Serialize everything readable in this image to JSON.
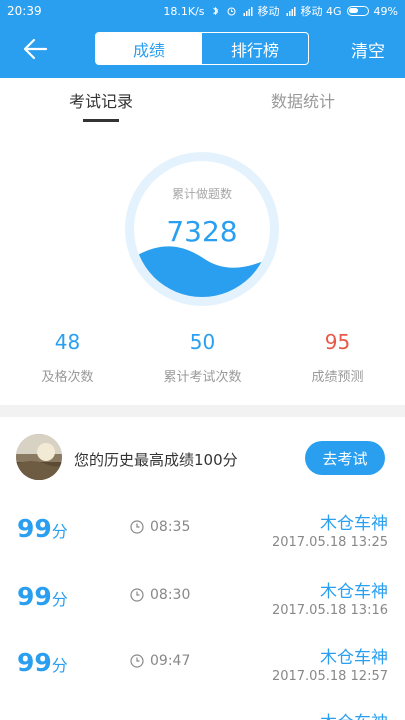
{
  "status_bar": {
    "time": "20:39",
    "speed": "18.1K/s",
    "carrier1": "移动",
    "carrier2": "移动 4G",
    "battery": "49%"
  },
  "nav": {
    "back_icon": "back-arrow-icon",
    "segments": [
      "成绩",
      "排行榜"
    ],
    "active_segment": "成绩",
    "clear_label": "清空"
  },
  "tabs": {
    "items": [
      "考试记录",
      "数据统计"
    ],
    "active": "考试记录"
  },
  "gauge": {
    "label": "累计做题数",
    "value": "7328",
    "fill_fraction": 0.3
  },
  "stats": [
    {
      "value": "48",
      "label": "及格次数"
    },
    {
      "value": "50",
      "label": "累计考试次数"
    },
    {
      "value": "95",
      "label": "成绩预测"
    }
  ],
  "best": {
    "text": "您的历史最高成绩100分",
    "button_label": "去考试"
  },
  "records": [
    {
      "score": "99",
      "unit": "分",
      "duration": "08:35",
      "name": "木仓车神",
      "date": "2017.05.18  13:25"
    },
    {
      "score": "99",
      "unit": "分",
      "duration": "08:30",
      "name": "木仓车神",
      "date": "2017.05.18  13:16"
    },
    {
      "score": "99",
      "unit": "分",
      "duration": "09:47",
      "name": "木仓车神",
      "date": "2017.05.18  12:57"
    },
    {
      "score": "",
      "unit": "",
      "duration": "",
      "name": "木仓车神",
      "date": ""
    }
  ],
  "colors": {
    "accent": "#2a9ff0",
    "prediction": "#e8594a",
    "divider": "#f2f2f2"
  }
}
